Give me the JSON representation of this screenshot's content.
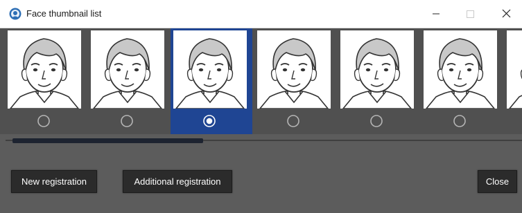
{
  "window": {
    "title": "Face thumbnail list",
    "controls": [
      "minimize-icon",
      "maximize-icon",
      "close-icon"
    ]
  },
  "thumbnails": [
    {
      "icon": "face-illustration",
      "selected": false
    },
    {
      "icon": "face-illustration",
      "selected": false
    },
    {
      "icon": "face-illustration",
      "selected": true
    },
    {
      "icon": "face-illustration",
      "selected": false
    },
    {
      "icon": "face-illustration",
      "selected": false
    },
    {
      "icon": "face-illustration",
      "selected": false
    },
    {
      "icon": "face-illustration",
      "selected": false
    }
  ],
  "footer": {
    "new_registration": "New registration",
    "additional_registration": "Additional registration",
    "close": "Close"
  },
  "colors": {
    "background": "#5c5c5c",
    "strip": "#505050",
    "selected": "#1f4593",
    "button": "#2b2b2b"
  }
}
